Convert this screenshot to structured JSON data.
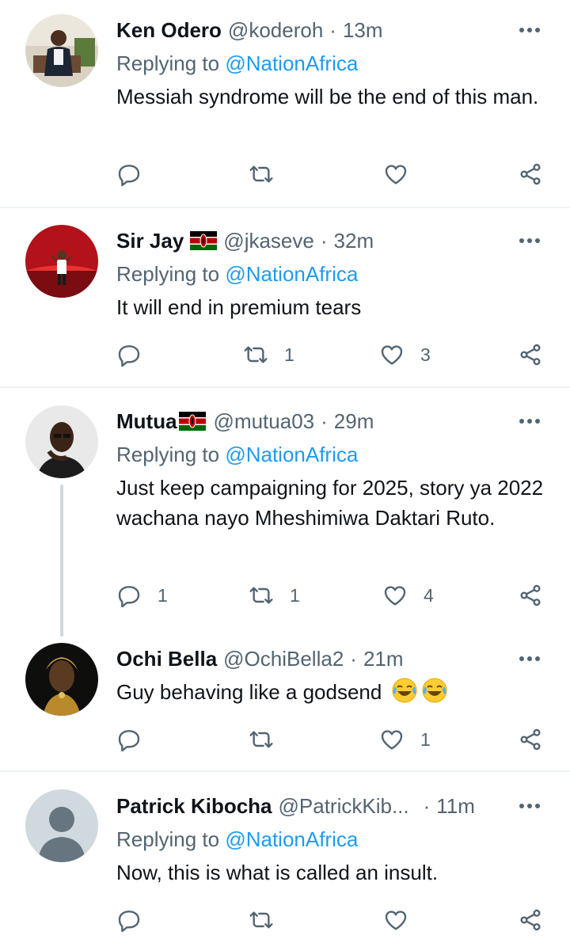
{
  "tweets": [
    {
      "name": "Ken Odero",
      "handle": "@koderoh",
      "time": "13m",
      "replying_label": "Replying to",
      "replying_to": "@NationAfrica",
      "text": "Messiah syndrome will be the end of this man.",
      "replies": "",
      "retweets": "",
      "likes": ""
    },
    {
      "name": "Sir Jay",
      "handle": "@jkaseve",
      "time": "32m",
      "replying_label": "Replying to",
      "replying_to": "@NationAfrica",
      "text": "It will end in premium tears",
      "replies": "",
      "retweets": "1",
      "likes": "3"
    },
    {
      "name": "Mutua",
      "handle": "@mutua03",
      "time": "29m",
      "replying_label": "Replying to",
      "replying_to": "@NationAfrica",
      "text": "Just keep campaigning for 2025, story ya 2022 wachana nayo Mheshimiwa Daktari Ruto.",
      "replies": "1",
      "retweets": "1",
      "likes": "4"
    },
    {
      "name": "Ochi Bella",
      "handle": "@OchiBella2",
      "time": "21m",
      "text": "Guy behaving like a godsend",
      "replies": "",
      "retweets": "",
      "likes": "1"
    },
    {
      "name": "Patrick Kibocha",
      "handle": "@PatrickKib...",
      "time": "11m",
      "replying_label": "Replying to",
      "replying_to": "@NationAfrica",
      "text": "Now, this is what is called an insult.",
      "replies": "",
      "retweets": "",
      "likes": ""
    }
  ],
  "separator": "·",
  "icons": {
    "more": "more-horizontal-icon",
    "reply": "reply-icon",
    "retweet": "retweet-icon",
    "like": "heart-icon",
    "share": "share-icon",
    "flag": "kenya-flag-icon",
    "emoji": "face-with-tears-of-joy-emoji"
  },
  "colors": {
    "text": "#0f1419",
    "secondary": "#536471",
    "link": "#1d9bf0",
    "divider": "#eff3f4"
  }
}
